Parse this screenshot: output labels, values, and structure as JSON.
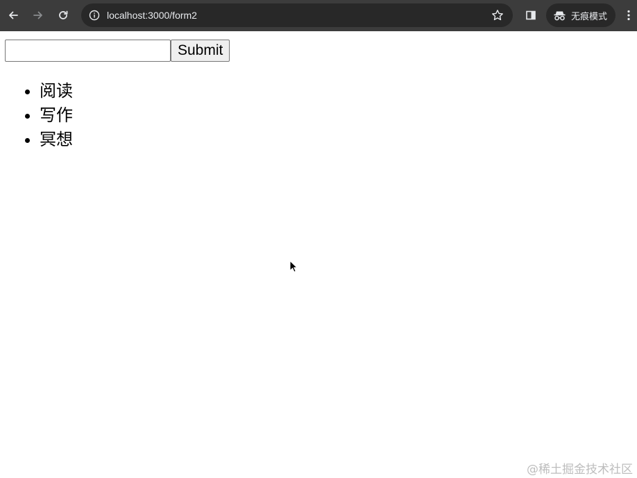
{
  "browser": {
    "url": "localhost:3000/form2",
    "mode_label": "无痕模式",
    "icons": {
      "back": "arrow-left-icon",
      "forward": "arrow-right-icon",
      "reload": "reload-icon",
      "site_info": "info-icon",
      "bookmark": "star-icon",
      "side_panel": "side-panel-icon",
      "incognito": "incognito-icon",
      "menu": "more-vert-icon"
    }
  },
  "form": {
    "input_value": "",
    "submit_label": "Submit"
  },
  "list": {
    "items": [
      "阅读",
      "写作",
      "冥想"
    ]
  },
  "watermark": "@稀土掘金技术社区",
  "colors": {
    "toolbar": "#3c3c3c",
    "omnibox": "#282828",
    "page_background": "#ffffff"
  }
}
